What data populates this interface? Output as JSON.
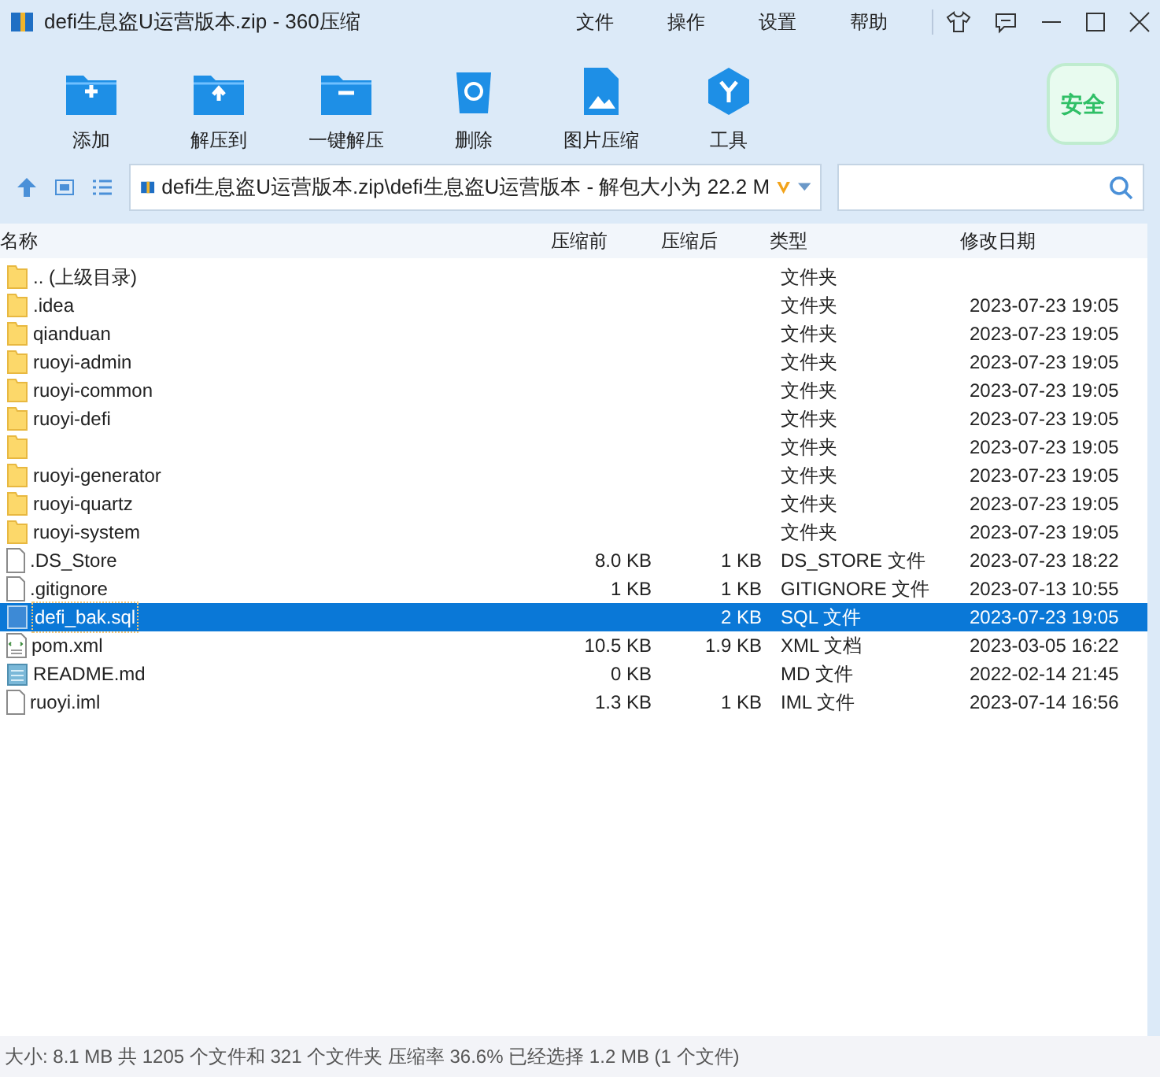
{
  "window": {
    "title": "defi生息盗U运营版本.zip - 360压缩"
  },
  "menu": [
    "文件",
    "操作",
    "设置",
    "帮助"
  ],
  "toolbar": [
    {
      "label": "添加",
      "kind": "add"
    },
    {
      "label": "解压到",
      "kind": "extract"
    },
    {
      "label": "一键解压",
      "kind": "oneclick"
    },
    {
      "label": "删除",
      "kind": "delete"
    },
    {
      "label": "图片压缩",
      "kind": "image"
    },
    {
      "label": "工具",
      "kind": "tools"
    }
  ],
  "security_badge": "安全",
  "address": {
    "path": "defi生息盗U运营版本.zip\\defi生息盗U运营版本 - 解包大小为 22.2 M"
  },
  "columns": [
    "名称",
    "压缩前",
    "压缩后",
    "类型",
    "修改日期"
  ],
  "rows": [
    {
      "kind": "folder",
      "name": ".. (上级目录)",
      "type": "文件夹",
      "selected": false
    },
    {
      "kind": "folder",
      "name": ".idea",
      "type": "文件夹",
      "date": "2023-07-23 19:05",
      "selected": false
    },
    {
      "kind": "folder",
      "name": "qianduan",
      "type": "文件夹",
      "date": "2023-07-23 19:05",
      "selected": false
    },
    {
      "kind": "folder",
      "name": "ruoyi-admin",
      "type": "文件夹",
      "date": "2023-07-23 19:05",
      "selected": false
    },
    {
      "kind": "folder",
      "name": "ruoyi-common",
      "type": "文件夹",
      "date": "2023-07-23 19:05",
      "selected": false
    },
    {
      "kind": "folder",
      "name": "ruoyi-defi",
      "type": "文件夹",
      "date": "2023-07-23 19:05",
      "selected": false
    },
    {
      "kind": "folder",
      "type": "文件夹",
      "date": "2023-07-23 19:05",
      "selected": false
    },
    {
      "kind": "folder",
      "name": "ruoyi-generator",
      "type": "文件夹",
      "date": "2023-07-23 19:05",
      "selected": false
    },
    {
      "kind": "folder",
      "name": "ruoyi-quartz",
      "type": "文件夹",
      "date": "2023-07-23 19:05",
      "selected": false
    },
    {
      "kind": "folder",
      "name": "ruoyi-system",
      "type": "文件夹",
      "date": "2023-07-23 19:05",
      "selected": false
    },
    {
      "kind": "file",
      "name": ".DS_Store",
      "size": "8.0 KB",
      "packed": "1 KB",
      "type": "DS_STORE 文件",
      "date": "2023-07-23 18:22",
      "selected": false
    },
    {
      "kind": "file",
      "name": ".gitignore",
      "size": "1 KB",
      "packed": "1 KB",
      "type": "GITIGNORE 文件",
      "date": "2023-07-13 10:55",
      "selected": false
    },
    {
      "kind": "sql",
      "name": "defi_bak.sql",
      "packed": "2 KB",
      "type": "SQL 文件",
      "date": "2023-07-23 19:05",
      "selected": true
    },
    {
      "kind": "xml",
      "name": "pom.xml",
      "size": "10.5 KB",
      "packed": "1.9 KB",
      "type": "XML 文档",
      "date": "2023-03-05 16:22",
      "selected": false
    },
    {
      "kind": "text",
      "name": "README.md",
      "size": "0 KB",
      "type": "MD 文件",
      "date": "2022-02-14 21:45",
      "selected": false
    },
    {
      "kind": "file",
      "name": "ruoyi.iml",
      "size": "1.3 KB",
      "packed": "1 KB",
      "type": "IML 文件",
      "date": "2023-07-14 16:56",
      "selected": false
    }
  ],
  "status_bar": "大小: 8.1 MB 共 1205 个文件和 321 个文件夹 压缩率 36.6% 已经选择 1.2 MB (1 个文件)"
}
